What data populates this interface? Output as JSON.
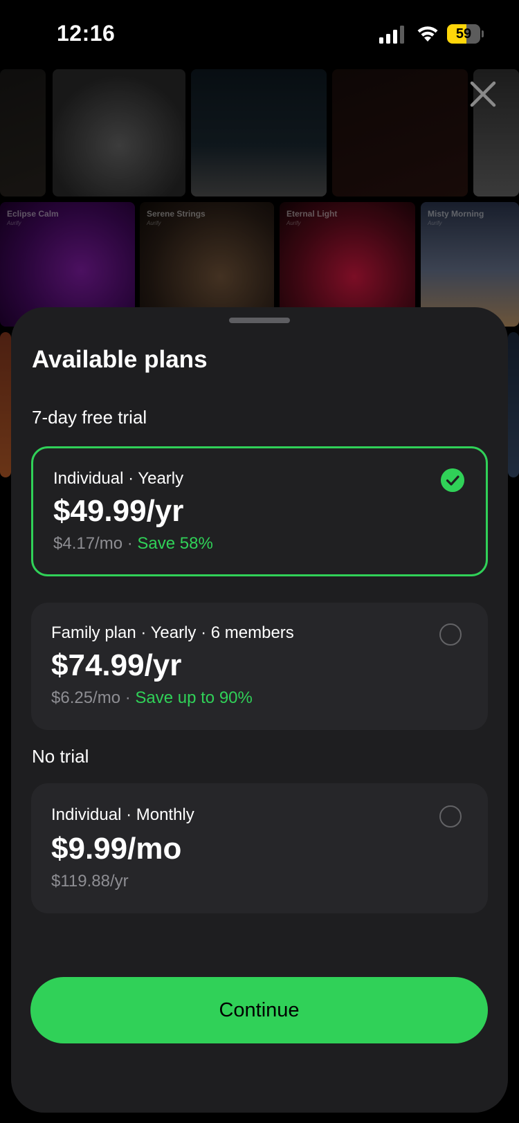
{
  "status_bar": {
    "time": "12:16",
    "battery": "59",
    "battery_level": 0.59
  },
  "background_tiles": [
    {
      "title": "Eclipse Calm",
      "subtitle": "Aurify"
    },
    {
      "title": "Serene Strings",
      "subtitle": "Aurify"
    },
    {
      "title": "Eternal Light",
      "subtitle": "Aurify"
    },
    {
      "title": "Misty Morning",
      "subtitle": "Aurify"
    }
  ],
  "sheet": {
    "title": "Available plans",
    "trial_section": "7-day free trial",
    "no_trial_section": "No trial",
    "plans": [
      {
        "name": "Individual · Yearly",
        "price": "$49.99/yr",
        "monthly": "$4.17/mo",
        "sep": " · ",
        "save": "Save 58%",
        "selected": true
      },
      {
        "name": "Family plan · Yearly · 6 members",
        "price": "$74.99/yr",
        "monthly": "$6.25/mo",
        "sep": " · ",
        "save": "Save up to 90%",
        "selected": false
      },
      {
        "name": "Individual · Monthly",
        "price": "$9.99/mo",
        "monthly": "$119.88/yr",
        "sep": "",
        "save": "",
        "selected": false
      }
    ],
    "continue_label": "Continue"
  },
  "colors": {
    "accent": "#30d158",
    "sheet_bg": "#1e1e20",
    "card_bg": "#262629",
    "muted": "#8e8e93"
  }
}
